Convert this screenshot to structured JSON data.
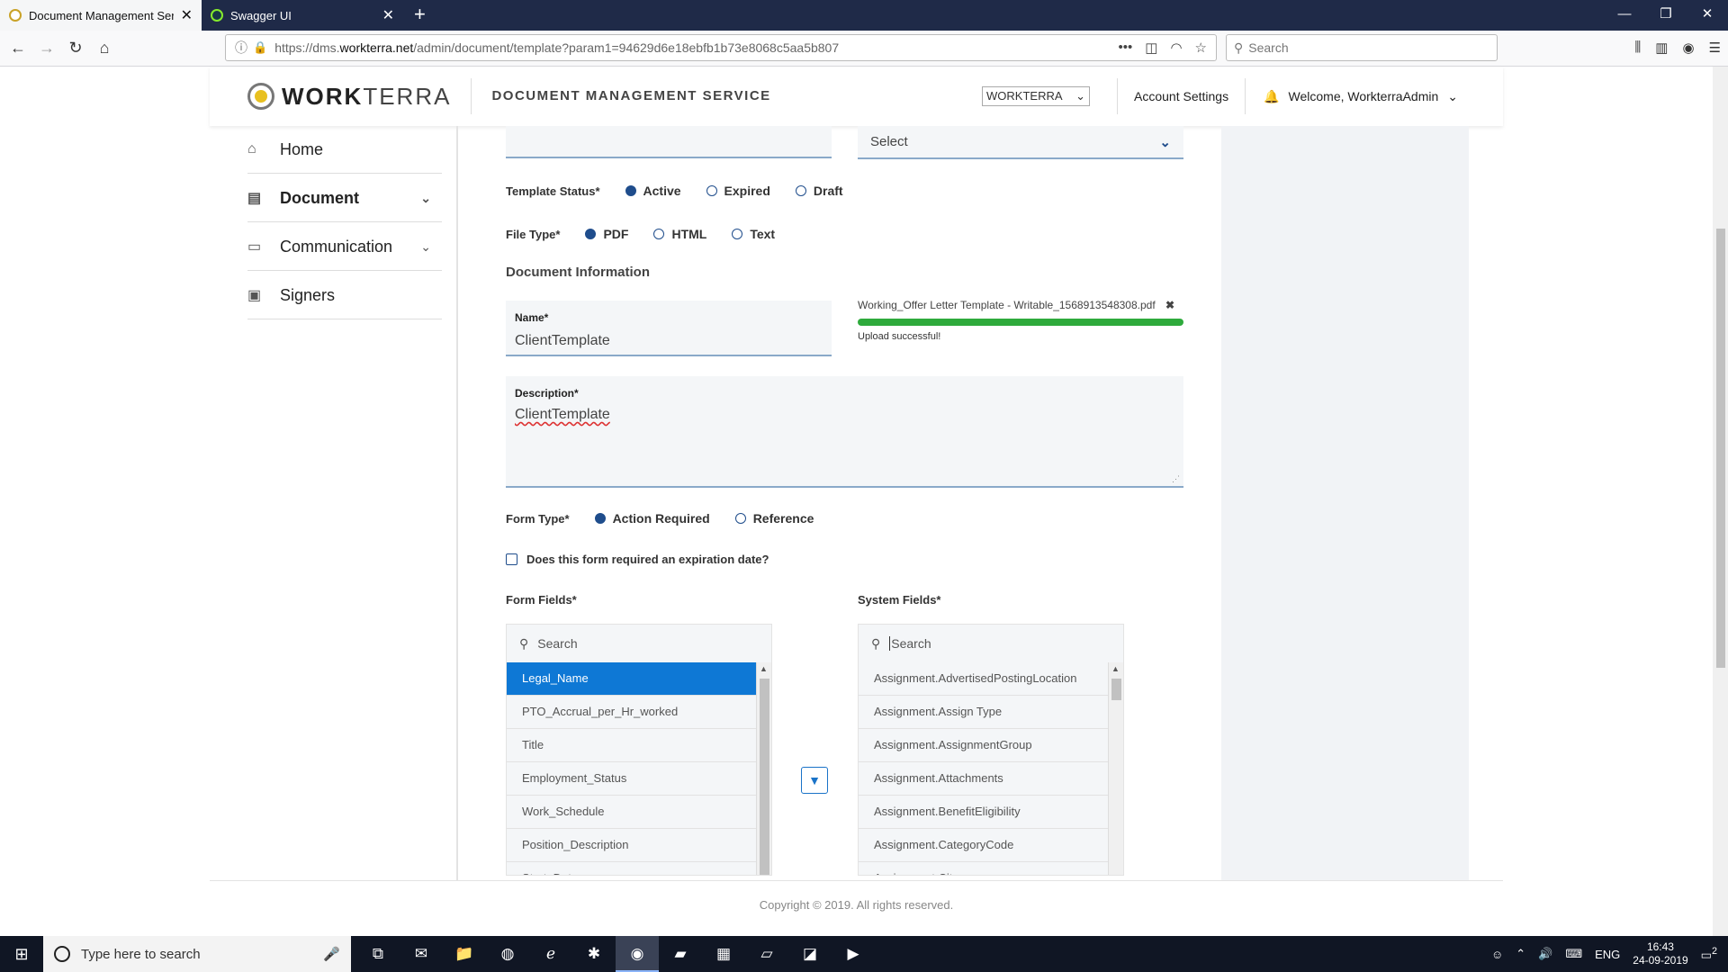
{
  "browser": {
    "tabs": [
      {
        "title": "Document Management Servic",
        "active": true
      },
      {
        "title": "Swagger UI",
        "active": false
      }
    ],
    "url_prefix": "https://dms.",
    "url_host": "workterra.net",
    "url_path": "/admin/document/template?param1=94629d6e18ebfb1b73e8068c5aa5b807",
    "search_placeholder": "Search"
  },
  "header": {
    "brand_bold": "WORK",
    "brand_light": "TERRA",
    "service_name": "DOCUMENT MANAGEMENT SERVICE",
    "org_select": "WORKTERRA",
    "account_settings": "Account Settings",
    "welcome": "Welcome, WorkterraAdmin"
  },
  "sidebar": {
    "items": [
      {
        "label": "Home"
      },
      {
        "label": "Document"
      },
      {
        "label": "Communication"
      },
      {
        "label": "Signers"
      }
    ]
  },
  "form": {
    "top_select_placeholder": "Select",
    "template_status": {
      "label": "Template Status*",
      "options": [
        "Active",
        "Expired",
        "Draft"
      ],
      "selected": "Active"
    },
    "file_type": {
      "label": "File Type*",
      "options": [
        "PDF",
        "HTML",
        "Text"
      ],
      "selected": "PDF"
    },
    "doc_info_heading": "Document Information",
    "name": {
      "label": "Name*",
      "value": "ClientTemplate"
    },
    "upload": {
      "filename": "Working_Offer Letter Template - Writable_1568913548308.pdf",
      "status": "Upload successful!",
      "progress": 1.0
    },
    "description": {
      "label": "Description*",
      "value": "ClientTemplate"
    },
    "form_type": {
      "label": "Form Type*",
      "options": [
        "Action Required",
        "Reference"
      ],
      "selected": "Action Required"
    },
    "expiration_checkbox": "Does this form required an expiration date?",
    "form_fields": {
      "label": "Form Fields*",
      "search_placeholder": "Search",
      "items": [
        "Legal_Name",
        "PTO_Accrual_per_Hr_worked",
        "Title",
        "Employment_Status",
        "Work_Schedule",
        "Position_Description",
        "Start_Date"
      ]
    },
    "system_fields": {
      "label": "System Fields*",
      "search_placeholder": "Search",
      "items": [
        "Assignment.AdvertisedPostingLocation",
        "Assignment.Assign Type",
        "Assignment.AssignmentGroup",
        "Assignment.Attachments",
        "Assignment.BenefitEligibility",
        "Assignment.CategoryCode",
        "Assignment.City"
      ]
    }
  },
  "footer": {
    "copyright": "Copyright © 2019. All rights reserved."
  },
  "taskbar": {
    "search_placeholder": "Type here to search",
    "lang": "ENG",
    "time": "16:43",
    "date": "24-09-2019",
    "notifications": "2"
  }
}
